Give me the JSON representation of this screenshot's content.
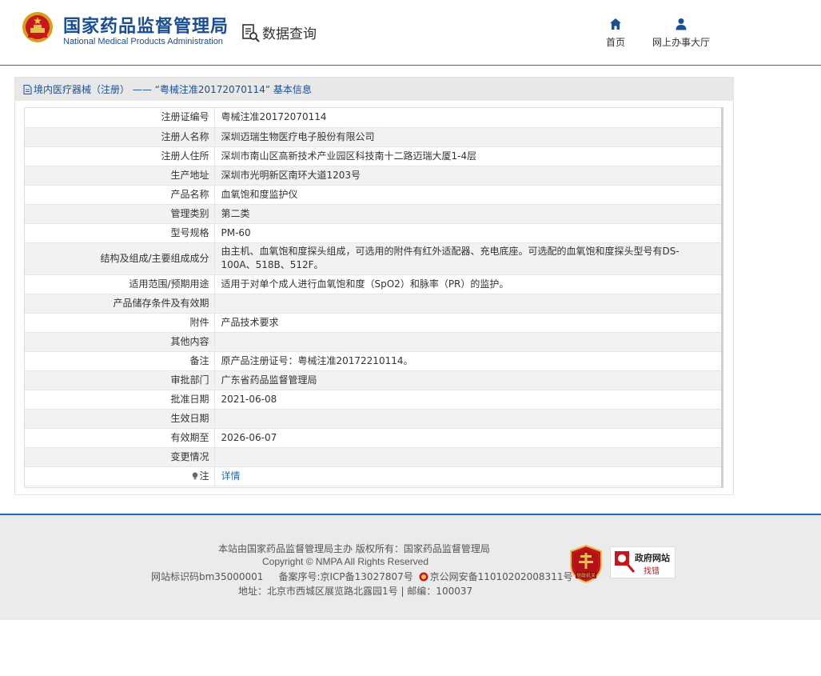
{
  "header": {
    "logo_cn": "国家药品监督管理局",
    "logo_en": "National Medical Products Administration",
    "data_query": "数据查询",
    "nav_home": "首页",
    "nav_hall": "网上办事大厅"
  },
  "panel": {
    "breadcrumb": "境内医疗器械（注册） —— “粤械注准20172070114” 基本信息"
  },
  "rows": [
    {
      "label": "注册证编号",
      "value": "粤械注准20172070114"
    },
    {
      "label": "注册人名称",
      "value": "深圳迈瑞生物医疗电子股份有限公司"
    },
    {
      "label": "注册人住所",
      "value": "深圳市南山区高新技术产业园区科技南十二路迈瑞大厦1-4层"
    },
    {
      "label": "生产地址",
      "value": "深圳市光明新区南环大道1203号"
    },
    {
      "label": "产品名称",
      "value": "血氧饱和度监护仪"
    },
    {
      "label": "管理类别",
      "value": "第二类"
    },
    {
      "label": "型号规格",
      "value": "PM-60"
    },
    {
      "label": "结构及组成/主要组成成分",
      "value": "由主机、血氧饱和度探头组成，可选用的附件有红外适配器、充电底座。可选配的血氧饱和度探头型号有DS-100A、518B、512F。"
    },
    {
      "label": "适用范围/预期用途",
      "value": "适用于对单个成人进行血氧饱和度（SpO2）和脉率（PR）的监护。"
    },
    {
      "label": "产品储存条件及有效期",
      "value": ""
    },
    {
      "label": "附件",
      "value": "产品技术要求"
    },
    {
      "label": "其他内容",
      "value": ""
    },
    {
      "label": "备注",
      "value": "原产品注册证号：粤械注准20172210114。"
    },
    {
      "label": "审批部门",
      "value": "广东省药品监督管理局"
    },
    {
      "label": "批准日期",
      "value": "2021-06-08"
    },
    {
      "label": "生效日期",
      "value": ""
    },
    {
      "label": "有效期至",
      "value": "2026-06-07"
    },
    {
      "label": "变更情况",
      "value": ""
    },
    {
      "label": "注",
      "value": "详情"
    }
  ],
  "footer": {
    "line1": "本站由国家药品监督管理局主办 版权所有：国家药品监督管理局",
    "line2": "Copyright © NMPA All Rights Reserved",
    "site_id": "网站标识码bm35000001",
    "icp": "备案序号:京ICP备13027807号",
    "police": "京公网安备11010202008311号",
    "address": "地址：北京市西城区展览路北露园1号 | 邮编：100037",
    "seal_label": "党政机关",
    "gov_title": "政府网站",
    "gov_sub": "找错"
  },
  "colors": {
    "brand_blue": "#1a4e95",
    "link_blue": "#1e6cb8",
    "header_rule": "#1e6cb8",
    "row_alt": "#f2f2f2",
    "footer_bg": "#ebebeb"
  }
}
